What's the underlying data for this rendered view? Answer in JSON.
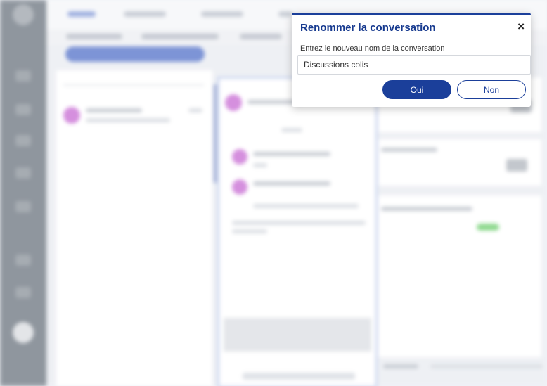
{
  "dialog": {
    "title": "Renommer la conversation",
    "field_label": "Entrez le nouveau nom de la conversation",
    "input_value": "Discussions colis",
    "confirm_label": "Oui",
    "cancel_label": "Non",
    "close_icon": "×"
  },
  "colors": {
    "accent": "#1b3f9a",
    "avatar": "#d58fde",
    "sidebar": "#8f969e"
  },
  "icons": [
    "close-icon"
  ]
}
